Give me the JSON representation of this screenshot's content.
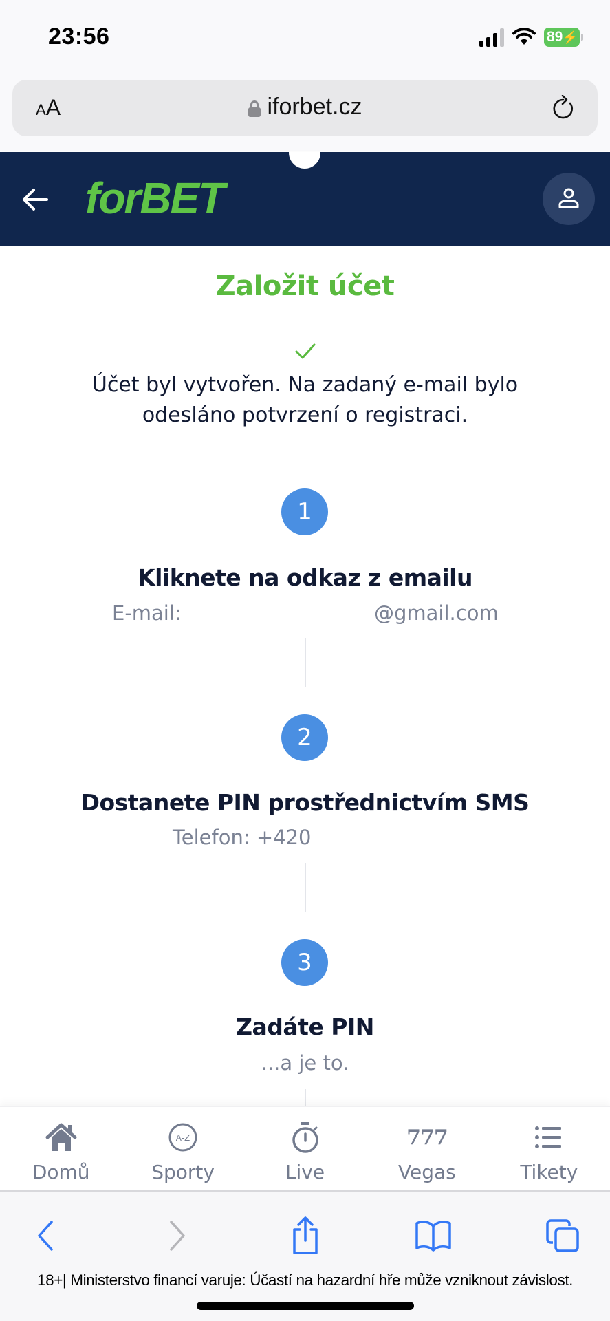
{
  "status_bar": {
    "time": "23:56",
    "battery": "89",
    "signal_bars_active": 3,
    "signal_bars_total": 4
  },
  "browser": {
    "text_size_small": "A",
    "text_size_big": "A",
    "url": "iforbet.cz",
    "icons": {
      "lock": "lock-icon",
      "reload": "reload-icon"
    }
  },
  "header": {
    "logo_prefix": "for",
    "logo_suffix": "BET",
    "icons": {
      "back": "arrow-left-icon",
      "user": "user-icon"
    },
    "colors": {
      "background": "#10264d",
      "logo": "#5fc447",
      "user_button": "#2c4168"
    }
  },
  "main": {
    "title": "Založit účet",
    "success_message": "Účet byl vytvořen. Na zadaný e-mail bylo odesláno potvrzení o registraci.",
    "steps": [
      {
        "number": "1",
        "title": "Kliknete na odkaz z emailu",
        "label": "E-mail:",
        "value": "@gmail.com"
      },
      {
        "number": "2",
        "title": "Dostanete PIN prostřednictvím SMS",
        "label": "Telefon: +420"
      },
      {
        "number": "3",
        "title": "Zadáte PIN",
        "label": "...a je to."
      }
    ],
    "colors": {
      "title": "#5aba3f",
      "step_circle": "#4a8fe2",
      "muted_text": "#7b8294"
    }
  },
  "bottom_nav": {
    "items": [
      {
        "label": "Domů",
        "icon": "home-icon"
      },
      {
        "label": "Sporty",
        "icon": "a-z-icon",
        "icon_text": "A-Z"
      },
      {
        "label": "Live",
        "icon": "stopwatch-icon"
      },
      {
        "label": "Vegas",
        "icon": "slot-777-icon",
        "icon_text": "777"
      },
      {
        "label": "Tikety",
        "icon": "list-icon"
      }
    ]
  },
  "safari_toolbar": {
    "buttons": [
      {
        "name": "back",
        "icon": "chevron-left-icon"
      },
      {
        "name": "forward",
        "icon": "chevron-right-icon"
      },
      {
        "name": "share",
        "icon": "share-icon"
      },
      {
        "name": "bookmarks",
        "icon": "book-icon"
      },
      {
        "name": "tabs",
        "icon": "tabs-icon"
      }
    ],
    "disclaimer": "18+| Ministerstvo financí varuje: Účastí na hazardní hře může vzniknout závislost."
  }
}
